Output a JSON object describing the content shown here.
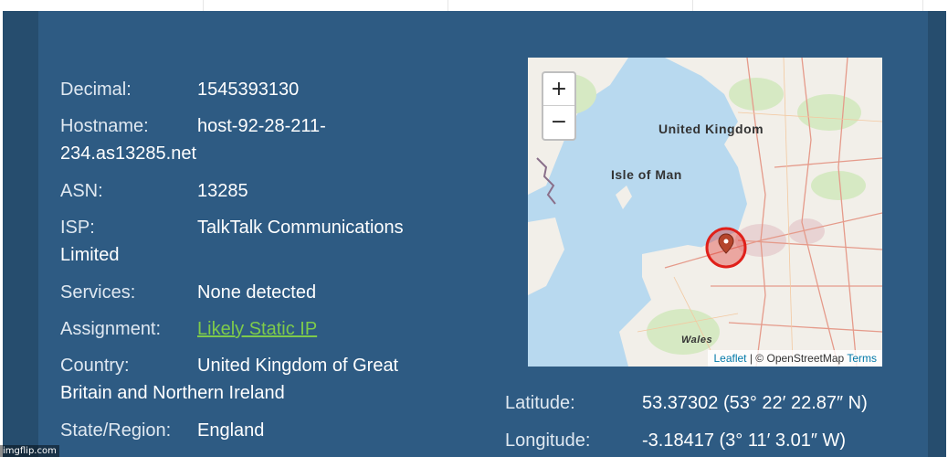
{
  "info": {
    "decimal": {
      "label": "Decimal:",
      "value": "1545393130"
    },
    "hostname": {
      "label": "Hostname:",
      "value_line1": "host-92-28-211-",
      "value_line2": "234.as13285.net"
    },
    "asn": {
      "label": "ASN:",
      "value": "13285"
    },
    "isp": {
      "label": "ISP:",
      "value_line1": "TalkTalk Communications",
      "value_line2": "Limited"
    },
    "services": {
      "label": "Services:",
      "value": "None detected"
    },
    "assignment": {
      "label": "Assignment:",
      "value": "Likely Static IP"
    },
    "country": {
      "label": "Country:",
      "value_line1": "United Kingdom of Great",
      "value_line2": "Britain and Northern Ireland"
    },
    "state": {
      "label": "State/Region:",
      "value": "England"
    }
  },
  "map": {
    "zoom_in": "+",
    "zoom_out": "−",
    "labels": {
      "uk": "United Kingdom",
      "iom": "Isle of Man",
      "wales": "Wales"
    },
    "attribution": {
      "leaflet": "Leaflet",
      "separator": " | © ",
      "osm": "OpenStreetMap",
      "terms": "Terms"
    },
    "marker_icon": "map-pin-icon"
  },
  "coords": {
    "latitude": {
      "label": "Latitude:",
      "value": "53.37302  (53° 22′ 22.87″ N)"
    },
    "longitude": {
      "label": "Longitude:",
      "value": "-3.18417  (3° 11′ 3.01″ W)"
    }
  },
  "watermark": "imgflip.com",
  "colors": {
    "panel": "#2e5b83",
    "frame": "#264d6e",
    "link": "#7ecb4b",
    "sea": "#b8d9ef",
    "land": "#f2efe9",
    "marker": "#e0201a"
  }
}
